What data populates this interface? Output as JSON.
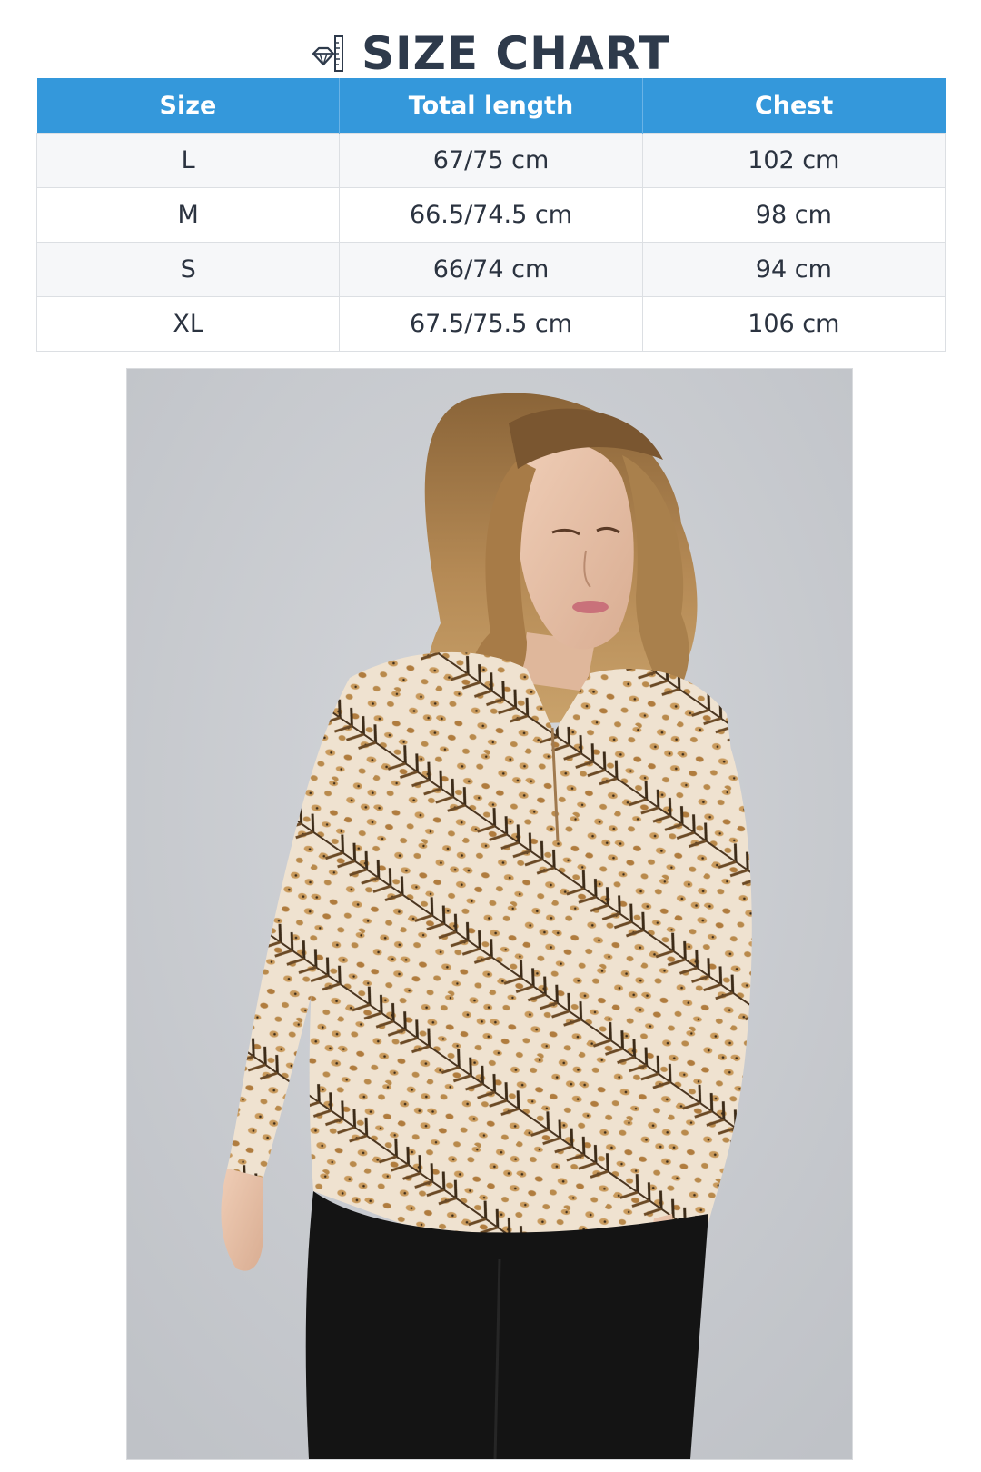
{
  "header": {
    "title": "SIZE CHART",
    "icon": "diamond-ruler-icon"
  },
  "table": {
    "columns": [
      "Size",
      "Total length",
      "Chest"
    ],
    "rows": [
      [
        "L",
        "67/75 cm",
        "102 cm"
      ],
      [
        "M",
        "66.5/74.5 cm",
        "98 cm"
      ],
      [
        "S",
        "66/74 cm",
        "94 cm"
      ],
      [
        "XL",
        "67.5/75.5 cm",
        "106 cm"
      ]
    ]
  },
  "colors": {
    "header_bg": "#3498db",
    "title": "#2e3a4b",
    "row_alt": "#f6f7f9",
    "photo_bg": "#c9ccd1"
  },
  "photo": {
    "subject": "model-wearing-printed-blouse"
  }
}
